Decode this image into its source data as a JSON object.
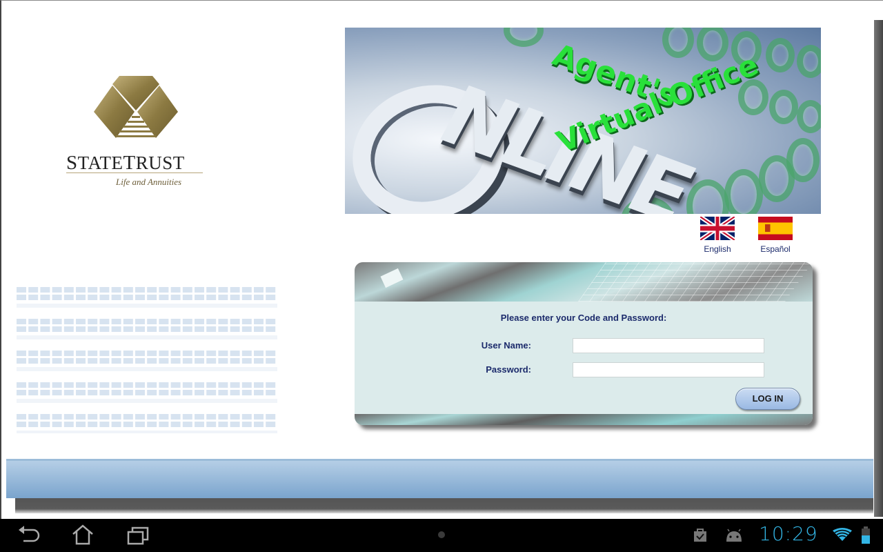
{
  "brand": {
    "name_first": "S",
    "name_rest_1": "TATE",
    "name_second": "T",
    "name_rest_2": "RUST",
    "tagline": "Life and Annuities",
    "gold": "#8f7d45"
  },
  "banner": {
    "line1": "Agent's",
    "line2": "ONLINE",
    "line2_rest": "NLINE",
    "line3": "Virtual Office",
    "accent": "#29e03a"
  },
  "languages": [
    {
      "label": "English",
      "flag": "uk-flag"
    },
    {
      "label": "Español",
      "flag": "spain-flag"
    }
  ],
  "login": {
    "prompt": "Please enter your Code and Password:",
    "username_label": "User Name:",
    "username_value": "",
    "password_label": "Password:",
    "password_value": "",
    "submit_label": "LOG IN"
  },
  "system_bar": {
    "time": "10:29",
    "accent": "#33b5e5",
    "icons": [
      "back-icon",
      "home-icon",
      "recent-apps-icon",
      "shopping-bag-icon",
      "android-debug-icon",
      "wifi-icon",
      "battery-icon"
    ]
  }
}
